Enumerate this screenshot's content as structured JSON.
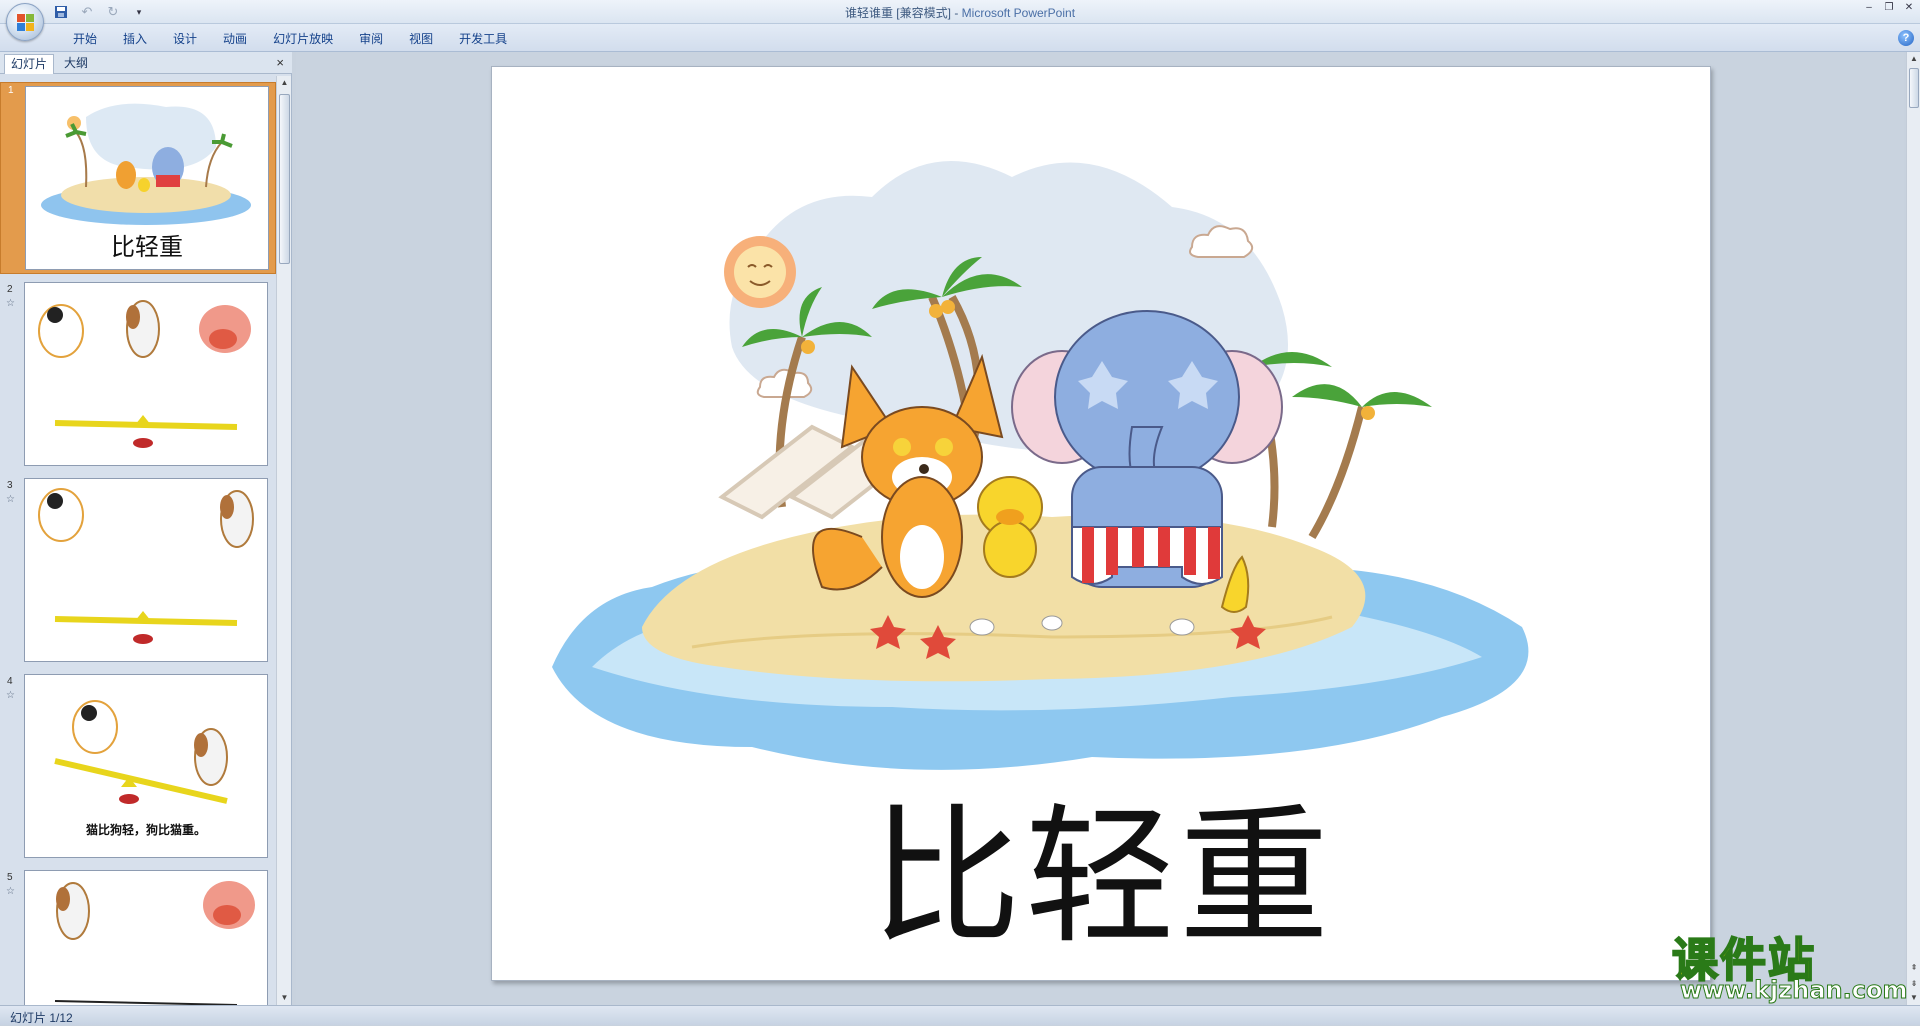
{
  "window": {
    "title_doc": "谁轻谁重 [兼容模式]",
    "title_sep": " - ",
    "title_app": "Microsoft PowerPoint"
  },
  "ribbon": {
    "tabs": [
      "开始",
      "插入",
      "设计",
      "动画",
      "幻灯片放映",
      "审阅",
      "视图",
      "开发工具"
    ]
  },
  "left_panel": {
    "tab_slides": "幻灯片",
    "tab_outline": "大纲",
    "close": "×"
  },
  "thumbnails": [
    {
      "num": "1",
      "title": "比轻重"
    },
    {
      "num": "2"
    },
    {
      "num": "3"
    },
    {
      "num": "4",
      "caption": "猫比狗轻，狗比猫重。"
    },
    {
      "num": "5"
    }
  ],
  "slide": {
    "title": "比轻重"
  },
  "status": {
    "slide_info": "幻灯片 1/12"
  },
  "watermark": {
    "name": "课件站",
    "url": "www.kjzhan.com"
  },
  "icons": {
    "office": "office-button-icon",
    "save": "save-icon",
    "undo": "undo-icon",
    "redo": "redo-icon",
    "customize": "dropdown-icon",
    "help": "help-icon"
  }
}
